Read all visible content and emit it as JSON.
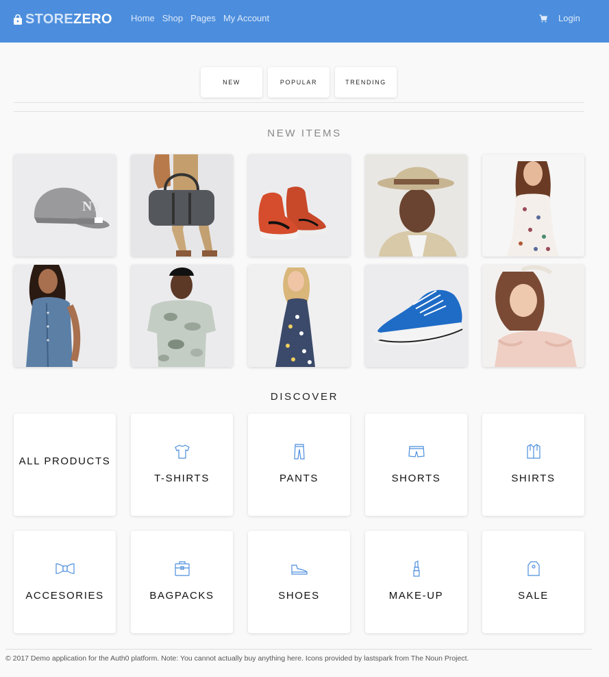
{
  "navbar": {
    "brand_part1": "STORE",
    "brand_part2": "ZERO",
    "links": [
      "Home",
      "Shop",
      "Pages",
      "My Account"
    ],
    "login": "Login",
    "color": "#4c8edd"
  },
  "tabs": [
    "NEW",
    "POPULAR",
    "TRENDING"
  ],
  "new_items": {
    "title": "NEW ITEMS",
    "products": [
      {
        "icon": "grey-baseball-cap"
      },
      {
        "icon": "grey-duffel-bag"
      },
      {
        "icon": "red-sneakers"
      },
      {
        "icon": "straw-hat-man"
      },
      {
        "icon": "floral-dress-woman"
      },
      {
        "icon": "denim-dress-woman"
      },
      {
        "icon": "camo-tshirt-man"
      },
      {
        "icon": "floral-sundress-woman"
      },
      {
        "icon": "blue-canvas-shoe"
      },
      {
        "icon": "pink-blouse-woman"
      }
    ]
  },
  "discover": {
    "title": "DISCOVER",
    "categories": [
      {
        "label": "ALL PRODUCTS",
        "icon": ""
      },
      {
        "label": "T-SHIRTS",
        "icon": "tshirt-icon"
      },
      {
        "label": "PANTS",
        "icon": "pants-icon"
      },
      {
        "label": "SHORTS",
        "icon": "shorts-icon"
      },
      {
        "label": "SHIRTS",
        "icon": "shirt-icon"
      },
      {
        "label": "ACCESORIES",
        "icon": "bowtie-icon"
      },
      {
        "label": "BAGPACKS",
        "icon": "backpack-icon"
      },
      {
        "label": "SHOES",
        "icon": "shoe-icon"
      },
      {
        "label": "MAKE-UP",
        "icon": "lipstick-icon"
      },
      {
        "label": "SALE",
        "icon": "tag-icon"
      }
    ],
    "icon_color": "#4c8edd"
  },
  "footer": "© 2017 Demo application for the Auth0 platform. Note: You cannot actually buy anything here. Icons provided by lastspark from The Noun Project."
}
